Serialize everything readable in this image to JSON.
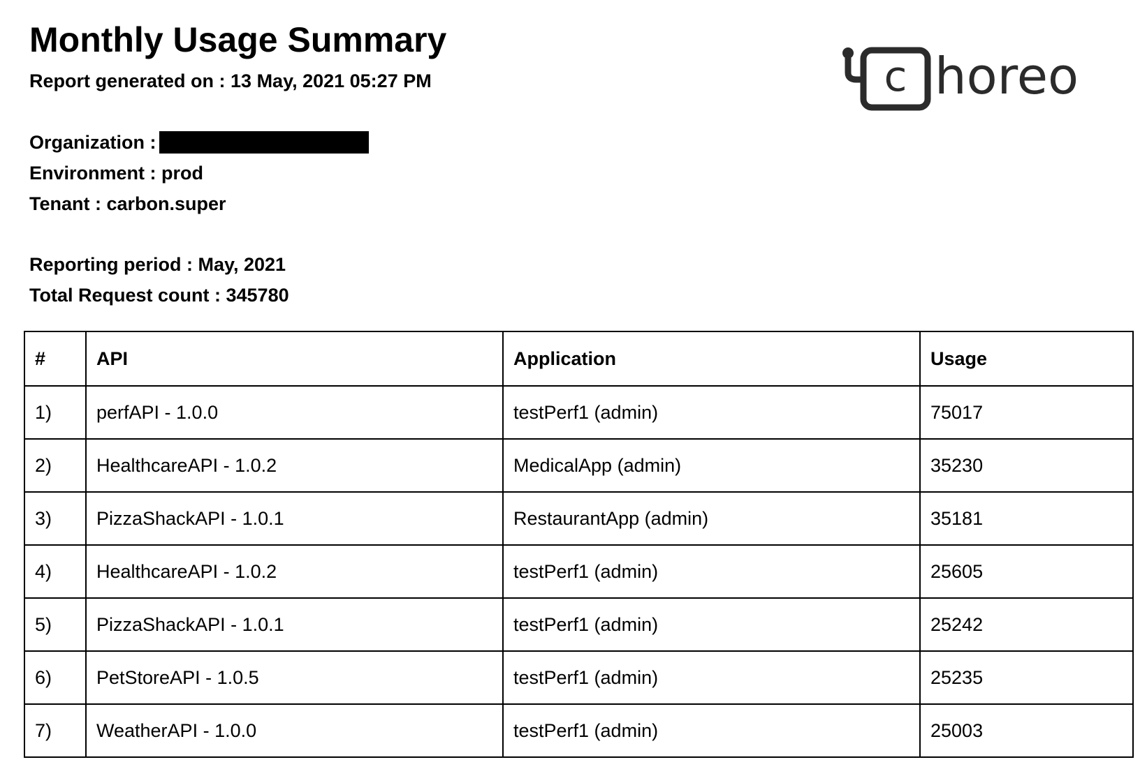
{
  "report": {
    "title": "Monthly Usage Summary",
    "generated_label": "Report generated on : ",
    "generated_value": "13 May, 2021 05:27 PM",
    "organization_label": "Organization :",
    "environment_label": "Environment : ",
    "environment_value": "prod",
    "tenant_label": "Tenant : ",
    "tenant_value": "carbon.super",
    "period_label": "Reporting period : ",
    "period_value": "May, 2021",
    "total_label": "Total Request count : ",
    "total_value": "345780"
  },
  "logo": {
    "text": "horeo",
    "letter": "c",
    "icon": "choreo-logo-icon",
    "color": "#2b2b2b"
  },
  "table": {
    "headers": [
      "#",
      "API",
      "Application",
      "Usage"
    ],
    "rows": [
      {
        "num": "1)",
        "api": "perfAPI - 1.0.0",
        "app": "testPerf1 (admin)",
        "usage": "75017"
      },
      {
        "num": "2)",
        "api": "HealthcareAPI - 1.0.2",
        "app": "MedicalApp (admin)",
        "usage": "35230"
      },
      {
        "num": "3)",
        "api": "PizzaShackAPI - 1.0.1",
        "app": "RestaurantApp (admin)",
        "usage": "35181"
      },
      {
        "num": "4)",
        "api": "HealthcareAPI - 1.0.2",
        "app": "testPerf1 (admin)",
        "usage": "25605"
      },
      {
        "num": "5)",
        "api": "PizzaShackAPI - 1.0.1",
        "app": "testPerf1 (admin)",
        "usage": "25242"
      },
      {
        "num": "6)",
        "api": "PetStoreAPI - 1.0.5",
        "app": "testPerf1 (admin)",
        "usage": "25235"
      },
      {
        "num": "7)",
        "api": "WeatherAPI - 1.0.0",
        "app": "testPerf1 (admin)",
        "usage": "25003"
      }
    ]
  },
  "colors": {
    "text": "#000000",
    "background": "#ffffff",
    "redaction": "#000000"
  }
}
